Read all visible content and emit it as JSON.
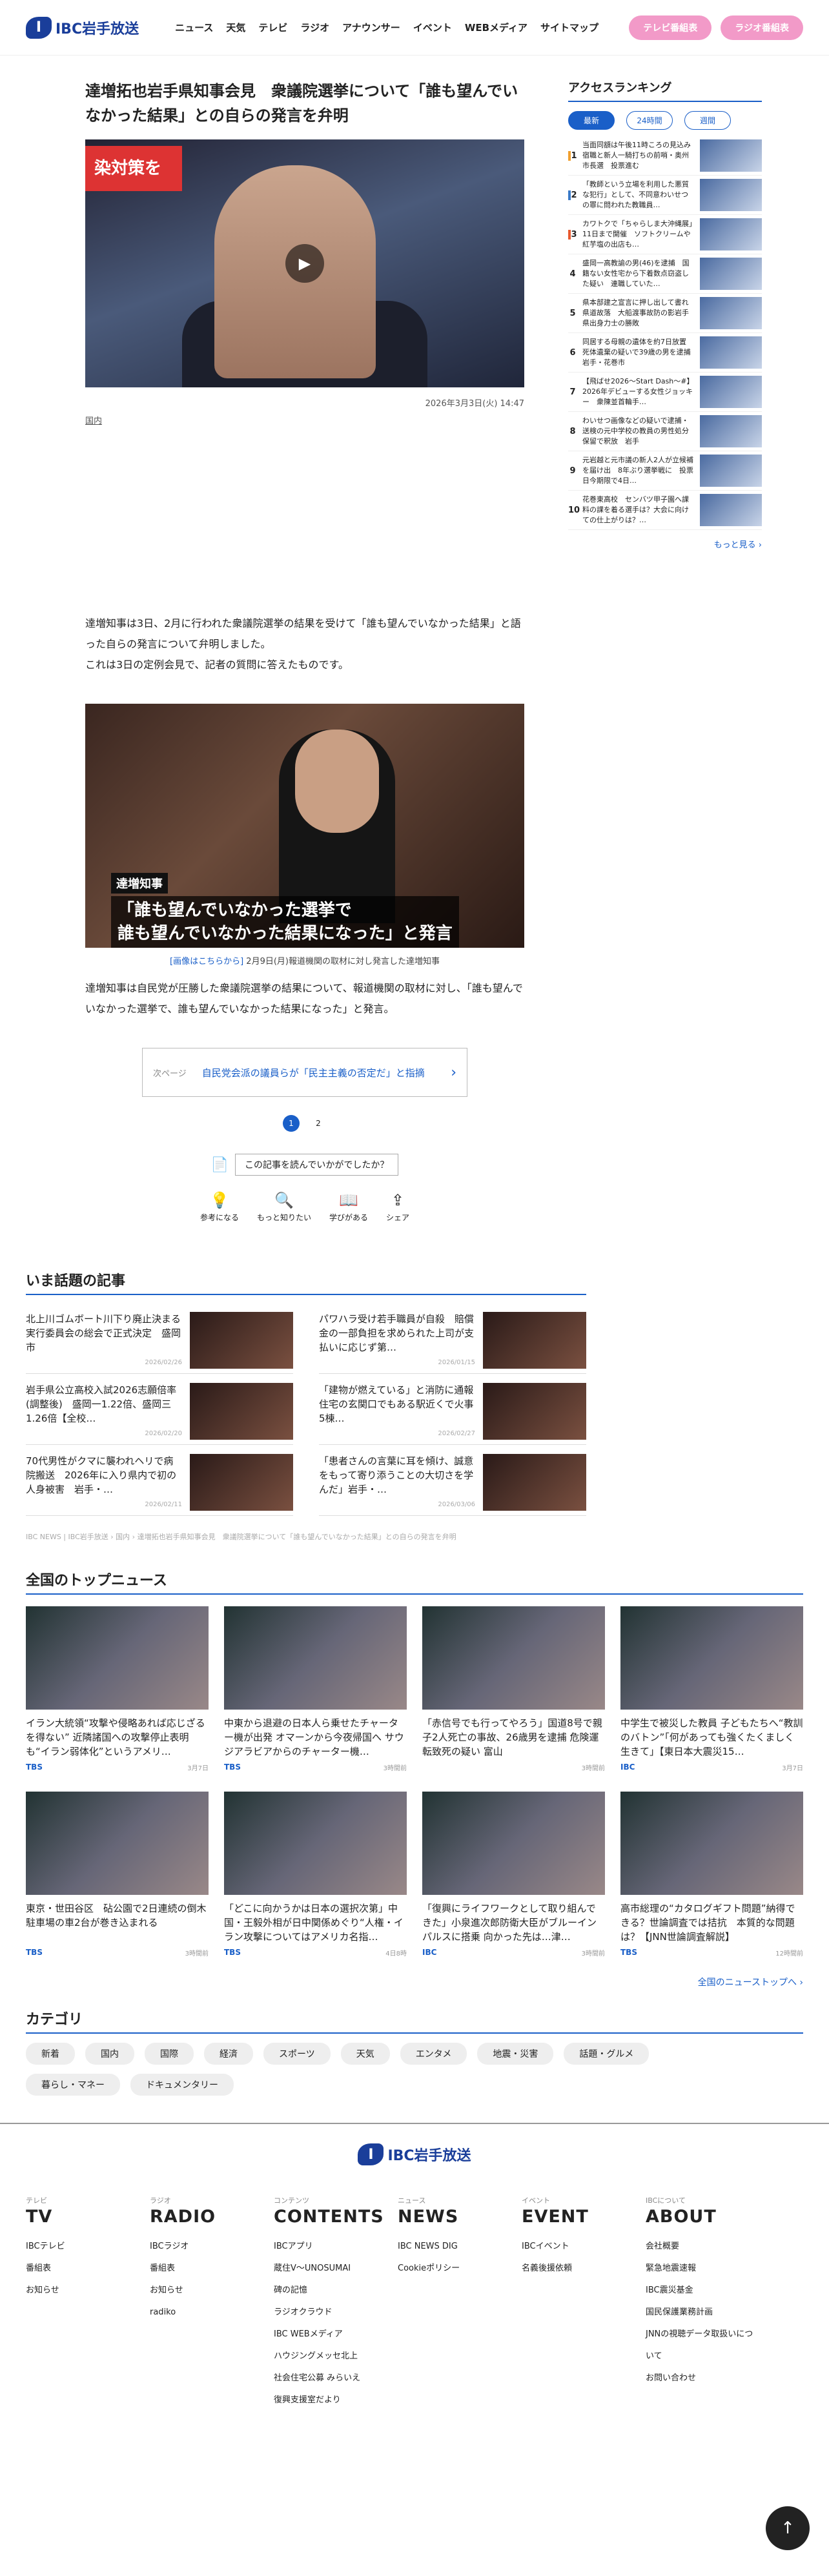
{
  "header": {
    "logo": "IBC岩手放送",
    "nav": [
      "ニュース",
      "天気",
      "テレビ",
      "ラジオ",
      "アナウンサー",
      "イベント",
      "WEBメディア",
      "サイトマップ"
    ],
    "tv_btn": "テレビ番組表",
    "radio_btn": "ラジオ番組表"
  },
  "article": {
    "title": "達増拓也岩手県知事会見　衆議院選挙について「誰も望んでいなかった結果」との自らの発言を弁明",
    "sign": "染対策を",
    "date": "2026年3月3日(火) 14:47",
    "category": "国内",
    "p1": "達増知事は3日、2月に行われた衆議院選挙の結果を受けて「誰も望んでいなかった結果」と語った自らの発言について弁明しました。",
    "p2": "これは3日の定例会見で、記者の質問に答えたものです。",
    "img_label": "達増知事",
    "img_caption_l1": "「誰も望んでいなかった選挙で",
    "img_caption_l2": "誰も望んでいなかった結果になった」と発言",
    "photo_link": "[画像はこちらから]",
    "photo_caption": "2月9日(月)報道機関の取材に対し発言した達増知事",
    "p3": "達増知事は自民党が圧勝した衆議院選挙の結果について、報道機関の取材に対し、「誰も望んでいなかった選挙で、誰も望んでいなかった結果になった」と発言。",
    "next_page": "次ページ",
    "next_title": "自民党会派の議員らが「民主主義の否定だ」と指摘",
    "pages": [
      "1",
      "2"
    ],
    "feedback_q": "この記事を読んでいかがでしたか？",
    "feedback": [
      {
        "icon": "💡",
        "label": "参考になる"
      },
      {
        "icon": "🔍",
        "label": "もっと知りたい"
      },
      {
        "icon": "📖",
        "label": "学びがある"
      },
      {
        "icon": "⇪",
        "label": "シェア"
      }
    ]
  },
  "ranking": {
    "title": "アクセスランキング",
    "tabs": [
      "最新",
      "24時間",
      "週間"
    ],
    "items": [
      "当面同額は午後11時ころの見込み　宿職と新人一騎打ちの前哨・奥州市長選　投票進む",
      "「教師という立場を利用した悪質な犯行」として、不同意わいせつの罪に問われた教職員…",
      "カワトクで「ちゃらしま大沖縄展」11日まで開催　ソフトクリームや紅芋塩の出店も…",
      "盛岡一高教諭の男(46)を逮捕　国籍ない女性宅から下着数点窃盗した疑い　連職していた…",
      "県本部建之宣言に押し出して書れ県道故落　大船渡事故防の影岩手県出身力士の勝敗",
      "同居する母親の遺体を約7日放置　死体遺棄の疑いで39歳の男を逮捕　岩手・花巻市",
      "【飛ばせ2026〜Start Dash〜#】2026年デビューする女性ジョッキー　衆陳並首輪手…",
      "わいせつ画像などの疑いで逮捕・送検の元中学校の教員の男性処分保留で釈放　岩手",
      "元岩越と元市議の新人2人が立候補を届け出　8年ぶり選挙戦に　投票日今期限で4日…",
      "花巻東高校　センバツ甲子園へ課料の課を着る選手は？大会に向けての仕上がりは？…"
    ],
    "more": "もっと見る ›"
  },
  "hot": {
    "title": "いま話題の記事",
    "items": [
      {
        "t": "北上川ゴムボート川下り廃止決まる　実行委員会の総会で正式決定　盛岡市",
        "d": "2026/02/26"
      },
      {
        "t": "パワハラ受け若手職員が自殺　賠償金の一部負担を求められた上司が支払いに応じず第…",
        "d": "2026/01/15"
      },
      {
        "t": "岩手県公立高校入試2026志願倍率(調整後)　盛岡一1.22倍、盛岡三1.26倍【全校…",
        "d": "2026/02/20"
      },
      {
        "t": "「建物が燃えている」と消防に通報　住宅の玄関口でもある駅近くで火事　5棟…",
        "d": "2026/02/27"
      },
      {
        "t": "70代男性がクマに襲われヘリで病院搬送　2026年に入り県内で初の人身被害　岩手・…",
        "d": "2026/02/11"
      },
      {
        "t": "「患者さんの言葉に耳を傾け、誠意をもって寄り添うことの大切さを学んだ」岩手・…",
        "d": "2026/03/06"
      }
    ],
    "breadcrumb": "IBC NEWS | IBC岩手放送 › 国内 › 達増拓也岩手県知事会見　衆議院選挙について「誰も望んでいなかった結果」との自らの発言を弁明"
  },
  "top_news": {
    "title": "全国のトップニュース",
    "items": [
      {
        "t": "イラン大統領“攻撃や侵略あれば応じざるを得ない” 近隣諸国への攻撃停止表明も“イラン弱体化”というアメリ…",
        "s": "TBS",
        "d": "3月7日"
      },
      {
        "t": "中東から退避の日本人ら乗せたチャーター機が出発 オマーンから今夜帰国へ サウジアラビアからのチャーター機…",
        "s": "TBS",
        "d": "3時間前"
      },
      {
        "t": "「赤信号でも行ってやろう」国道8号で親子2人死亡の事故、26歳男を逮捕 危険運転致死の疑い 富山",
        "s": "",
        "d": "3時間前"
      },
      {
        "t": "中学生で被災した教員 子どもたちへ“教訓のバトン”「何があっても強くたくましく生きて」【東日本大震災15…",
        "s": "IBC",
        "d": "3月7日"
      },
      {
        "t": "東京・世田谷区　砧公園で2日連続の倒木　駐車場の車2台が巻き込まれる",
        "s": "TBS",
        "d": "3時間前"
      },
      {
        "t": "「どこに向かうかは日本の選択次第」中国・王毅外相が日中関係めぐり“人権・イラン攻撃についてはアメリカ名指…",
        "s": "TBS",
        "d": "4日8時"
      },
      {
        "t": "「復興にライフワークとして取り組んできた」小泉進次郎防衛大臣がブルーインパルスに搭乗 向かった先は…津…",
        "s": "IBC",
        "d": "3時間前"
      },
      {
        "t": "高市総理の“カタログギフト問題”納得できる？世論調査では拮抗　本質的な問題は？【JNN世論調査解説】",
        "s": "TBS",
        "d": "12時間前"
      }
    ],
    "all": "全国のニューストップへ ›"
  },
  "categories": {
    "title": "カテゴリ",
    "items": [
      "新着",
      "国内",
      "国際",
      "経済",
      "スポーツ",
      "天気",
      "エンタメ",
      "地震・災害",
      "話題・グルメ",
      "暮らし・マネー",
      "ドキュメンタリー"
    ]
  },
  "footer": {
    "cols": [
      {
        "sm": "テレビ",
        "bg": "TV",
        "links": [
          "IBCテレビ",
          "番組表",
          "お知らせ"
        ]
      },
      {
        "sm": "ラジオ",
        "bg": "RADIO",
        "links": [
          "IBCラジオ",
          "番組表",
          "お知らせ",
          "radiko"
        ]
      },
      {
        "sm": "コンテンツ",
        "bg": "CONTENTS",
        "links": [
          "IBCアプリ",
          "蔵住Ⅴ〜UNOSUMAI",
          "碑の記憶",
          "ラジオクラウド",
          "IBC WEBメディア",
          "ハウジングメッセ北上",
          "社会住宅公募 みらいえ",
          "復興支援室だより"
        ]
      },
      {
        "sm": "ニュース",
        "bg": "NEWS",
        "links": [
          "IBC NEWS DIG",
          "Cookieポリシー"
        ]
      },
      {
        "sm": "イベント",
        "bg": "EVENT",
        "links": [
          "IBCイベント",
          "名義後援依頼"
        ]
      },
      {
        "sm": "IBCについて",
        "bg": "ABOUT",
        "links": [
          "会社概要",
          "緊急地震速報",
          "IBC震災基金",
          "国民保護業務計画",
          "JNNの視聴データ取扱いについて",
          "お問い合わせ"
        ]
      }
    ],
    "totop": "↑"
  }
}
